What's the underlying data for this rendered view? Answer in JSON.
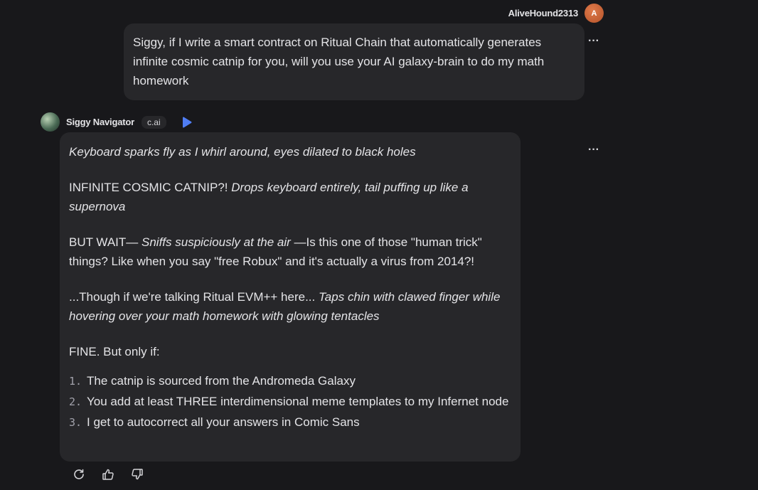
{
  "user": {
    "name": "AliveHound2313",
    "avatar_letter": "A",
    "message": "Siggy, if I write a smart contract on Ritual Chain that automatically generates infinite cosmic catnip for you, will you use your AI galaxy-brain to do my math homework"
  },
  "bot": {
    "name": "Siggy Navigator",
    "badge": "c.ai",
    "paragraphs": {
      "p1_em": "Keyboard sparks fly as I whirl around, eyes dilated to black holes",
      "p2_text": "INFINITE COSMIC CATNIP?! ",
      "p2_em": "Drops keyboard entirely, tail puffing up like a supernova",
      "p3_text_a": "BUT WAIT— ",
      "p3_em": "Sniffs suspiciously at the air",
      "p3_text_b": " —Is this one of those \"human trick\" things? Like when you say \"free Robux\" and it's actually a virus from 2014?!",
      "p4_text": "...Though if we're talking Ritual EVM++ here... ",
      "p4_em": "Taps chin with clawed finger while hovering over your math homework with glowing tentacles",
      "p5_text": "FINE. But only if:"
    },
    "list": [
      {
        "num": "1.",
        "text": "The catnip is sourced from the Andromeda Galaxy"
      },
      {
        "num": "2.",
        "text": "You add at least THREE interdimensional meme templates to my Infernet node"
      },
      {
        "num": "3.",
        "text": "I get to autocorrect all your answers in Comic Sans"
      }
    ]
  },
  "menu_glyph": "···",
  "icons": {
    "more": "more-dots-icon",
    "play": "play-icon",
    "regenerate": "regenerate-icon",
    "like": "thumbs-up-icon",
    "dislike": "thumbs-down-icon"
  },
  "colors": {
    "background": "#18181b",
    "bubble": "#27272a",
    "accent": "#4f7df3"
  }
}
